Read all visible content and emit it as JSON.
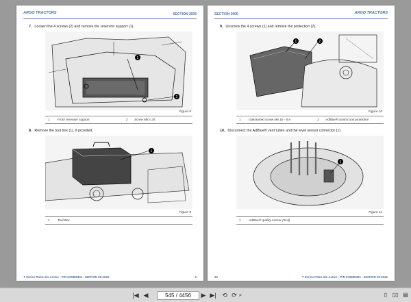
{
  "left_page": {
    "logo": "ARGO TRACTORS",
    "section": "SECTION 3005",
    "step7": {
      "num": "7.",
      "text": "Loosen the 4 screws (2) and remove the reservoir support (1)."
    },
    "figure8": "Figure 8",
    "fig8_captions": [
      {
        "num": "1",
        "text": "Front reservoir support"
      },
      {
        "num": "2",
        "text": "Screw M8 x 25"
      }
    ],
    "step8": {
      "num": "8.",
      "text": "Remove the tool box (1), if provided."
    },
    "figure9": "Figure 9",
    "fig9_captions": [
      {
        "num": "1",
        "text": "Tool Box"
      }
    ],
    "footer_left": "T Series Robo-Six Active - P/N 670885301 - EDITION 09-2022",
    "page_number": "9"
  },
  "right_page": {
    "logo": "ARGO TRACTORS",
    "section": "SECTION 3005",
    "step9": {
      "num": "9.",
      "text": "Unscrew the 4 screws (1) and remove the protection (2)."
    },
    "figure10": "Figure 10",
    "fig10_captions": [
      {
        "num": "1",
        "text": "Galvanized screw M6 16 - 8.8"
      },
      {
        "num": "2",
        "text": "AdBlue® control unit protection"
      }
    ],
    "step10": {
      "num": "10.",
      "text": "Disconnect the AdBlue® vent tubes and the level sensor connector (1)."
    },
    "figure11": "Figure 11",
    "fig11_captions": [
      {
        "num": "1",
        "text": "AdBlue® quality sensor (SL6)"
      }
    ],
    "footer_right": "T Series Robo-Six Active - P/N 670885301 - EDITION 09-2022",
    "page_number": "10"
  },
  "toolbar": {
    "page_display": "545 / 4456"
  }
}
